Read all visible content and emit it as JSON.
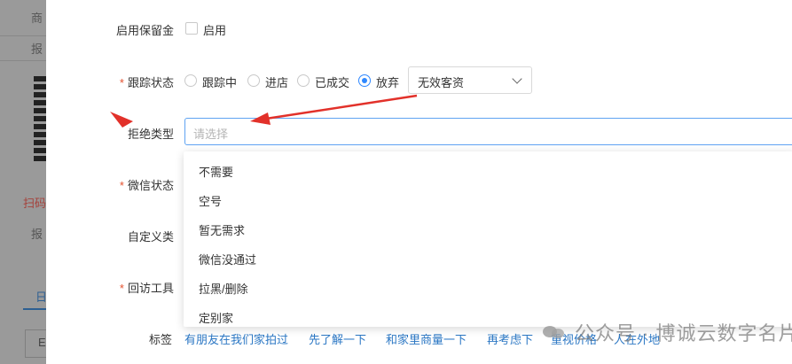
{
  "background": {
    "texts": [
      "商",
      "报",
      "扫码",
      "报",
      "日",
      "E"
    ]
  },
  "form": {
    "retain": {
      "label": "启用保留金",
      "option": "启用"
    },
    "tracking": {
      "label": "跟踪状态",
      "options": [
        "跟踪中",
        "进店",
        "已成交",
        "放弃"
      ],
      "selected": "放弃",
      "select_value": "无效客资"
    },
    "reject": {
      "label": "拒绝类型",
      "placeholder": "请选择"
    },
    "wechat": {
      "label": "微信状态"
    },
    "custom": {
      "label": "自定义类"
    },
    "revisit": {
      "label": "回访工具"
    },
    "tags": {
      "label": "标签",
      "items": [
        "有朋友在我们家拍过",
        "先了解一下",
        "和家里商量一下",
        "再考虑下",
        "重视价格",
        "人在外地"
      ]
    }
  },
  "dropdown": {
    "items": [
      "不需要",
      "空号",
      "暂无需求",
      "微信没通过",
      "拉黑/删除",
      "定别家"
    ]
  },
  "watermark": {
    "text": "公众号 · 博诚云数字名片"
  },
  "colors": {
    "accent": "#2f88ff",
    "required": "#e4522f",
    "annotation": "#e2312a",
    "link": "#2b77c4"
  }
}
